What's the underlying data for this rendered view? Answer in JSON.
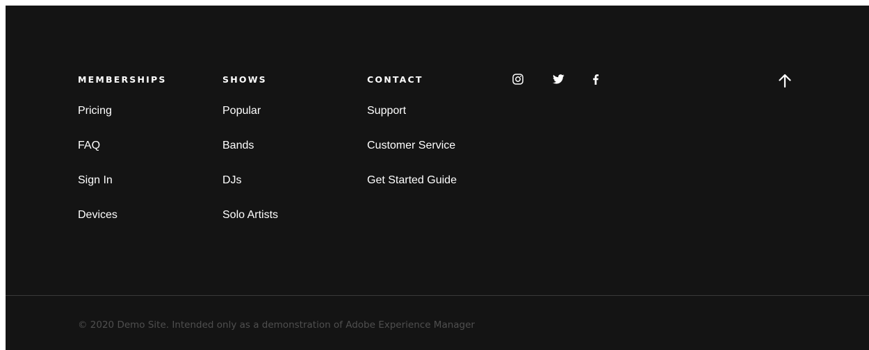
{
  "footer": {
    "columns": [
      {
        "heading": "MEMBERSHIPS",
        "links": [
          "Pricing",
          "FAQ",
          "Sign In",
          "Devices"
        ]
      },
      {
        "heading": "SHOWS",
        "links": [
          "Popular",
          "Bands",
          "DJs",
          "Solo Artists"
        ]
      },
      {
        "heading": "CONTACT",
        "links": [
          "Support",
          "Customer Service",
          "Get Started Guide"
        ]
      }
    ],
    "social": {
      "icons": [
        "instagram-icon",
        "twitter-icon",
        "facebook-icon"
      ]
    },
    "back_to_top_icon": "arrow-up-icon",
    "copyright": "© 2020 Demo Site. Intended only as a demonstration of Adobe Experience Manager"
  },
  "colors": {
    "background": "#141414",
    "text": "#ffffff",
    "copyright_text": "#4f4f4f",
    "divider": "#3a3a3a"
  }
}
